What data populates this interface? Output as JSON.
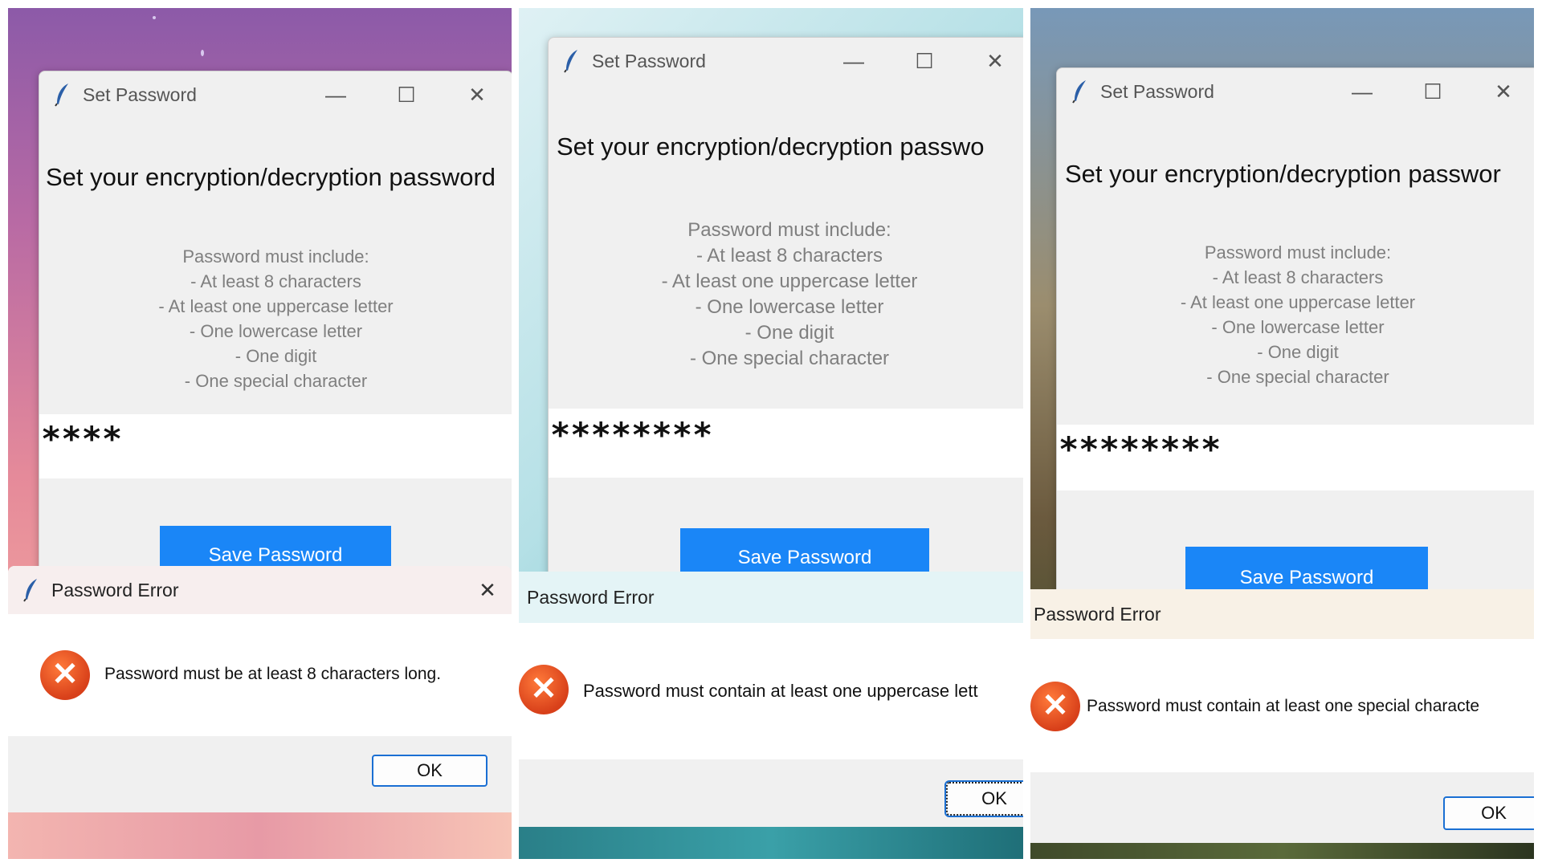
{
  "panels": [
    {
      "window_title": "Set Password",
      "heading": "Set your encryption/decryption password",
      "requirements": [
        "Password must include:",
        "- At least 8 characters",
        "- At least one uppercase letter",
        "- One lowercase letter",
        "- One digit",
        "- One special character"
      ],
      "password_masked": "****",
      "save_button": "Save Password",
      "dialog_title": "Password Error",
      "dialog_message": "Password must be at least 8 characters long.",
      "ok_button": "OK"
    },
    {
      "window_title": "Set Password",
      "heading": "Set your encryption/decryption passwo",
      "requirements": [
        "Password must include:",
        "- At least 8 characters",
        "- At least one uppercase letter",
        "- One lowercase letter",
        "- One digit",
        "- One special character"
      ],
      "password_masked": "********",
      "save_button": "Save Password",
      "dialog_title": "Password Error",
      "dialog_message": "Password must contain at least one uppercase lett",
      "ok_button": "OK"
    },
    {
      "window_title": "Set Password",
      "heading": "Set your encryption/decryption passwor",
      "requirements": [
        "Password must include:",
        "- At least 8 characters",
        "- At least one uppercase letter",
        "- One lowercase letter",
        "- One digit",
        "- One special character"
      ],
      "password_masked": "********",
      "save_button": "Save Password",
      "dialog_title": "Password Error",
      "dialog_message": "Password must contain at least one special characte",
      "ok_button": "OK"
    }
  ],
  "icons": {
    "app": "feather-icon",
    "minimize": "minimize-icon",
    "maximize": "maximize-icon",
    "close": "close-icon",
    "error": "error-icon"
  },
  "colors": {
    "save_button": "#1a86f7",
    "error_icon": "#e0481c",
    "ok_border": "#1a6fd3",
    "window_bg": "#f0f0f0"
  }
}
